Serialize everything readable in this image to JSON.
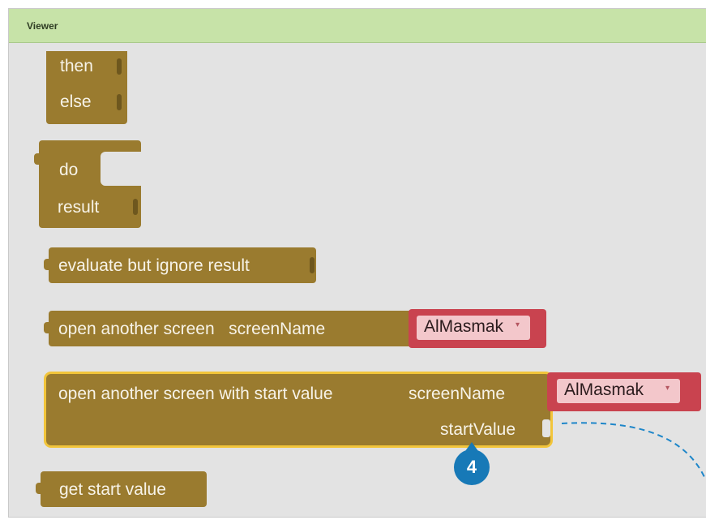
{
  "window": {
    "title": "Viewer"
  },
  "blocks": {
    "then_label": "then",
    "else_label": "else",
    "do_label": "do",
    "result_label": "result",
    "evaluate_label": "evaluate but ignore result",
    "open_screen": {
      "label": "open another screen",
      "param": "screenName",
      "value": "AlMasmak"
    },
    "open_screen_start": {
      "label": "open another screen with start value",
      "param_screen": "screenName",
      "param_start": "startValue",
      "value": "AlMasmak"
    },
    "get_start_label": "get start value"
  },
  "callout": {
    "number": "4"
  },
  "colors": {
    "control_block": "#9a7b2f",
    "text_block": "#c9434f",
    "selection_outline": "#f2c53b",
    "callout": "#1779b7",
    "header": "#c7e3a8"
  }
}
